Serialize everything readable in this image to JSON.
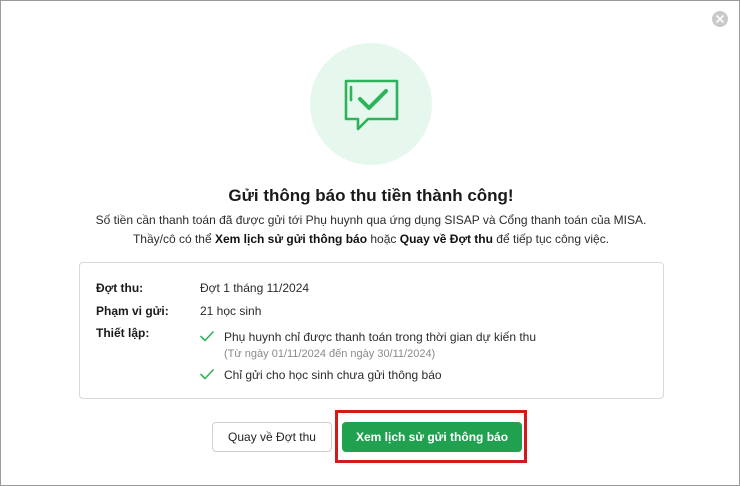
{
  "dialog": {
    "title": "Gửi thông báo thu tiền thành công!",
    "desc_line1": "Số tiền cần thanh toán đã được gửi tới Phụ huynh qua ứng dụng SISAP và Cổng thanh toán của MISA.",
    "desc_line2_a": "Thầy/cô có thể ",
    "desc_line2_b": "Xem lịch sử gửi thông báo",
    "desc_line2_c": " hoặc ",
    "desc_line2_d": "Quay về Đợt thu",
    "desc_line2_e": " để tiếp tục công việc."
  },
  "details": {
    "batch_label": "Đợt thu:",
    "batch_value": "Đợt 1 tháng 11/2024",
    "scope_label": "Phạm vi gửi:",
    "scope_value": "21 học sinh",
    "settings_label": "Thiết lập:",
    "settings": [
      {
        "text": "Phụ huynh chỉ được thanh toán trong thời gian dự kiến thu",
        "sub": "(Từ ngày 01/11/2024 đến ngày 30/11/2024)"
      },
      {
        "text": "Chỉ gửi cho học sinh chưa gửi thông báo"
      }
    ]
  },
  "buttons": {
    "back": "Quay về Đợt thu",
    "history": "Xem lịch sử gửi thông báo"
  },
  "colors": {
    "primary": "#1fa14f",
    "check": "#2fb35a",
    "highlight": "#d11a1a",
    "hero_bg": "#e6f8ee"
  }
}
